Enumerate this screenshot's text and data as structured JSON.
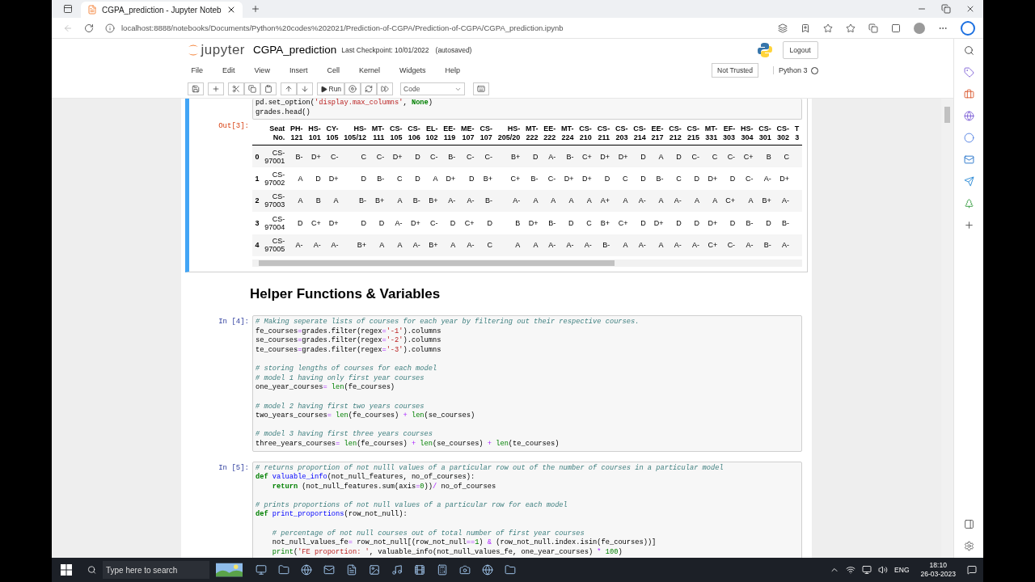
{
  "browser": {
    "tab": {
      "title": "CGPA_prediction - Jupyter Noteb",
      "selected": true
    },
    "url": "localhost:8888/notebooks/Documents/Python%20codes%202021/Prediction-of-CGPA/Prediction-of-CGPA/CGPA_prediction.ipynb"
  },
  "jupyter": {
    "logo": "jupyter",
    "notebook_name": "CGPA_prediction",
    "checkpoint": "Last Checkpoint: 10/01/2022",
    "autosave": "(autosaved)",
    "logout": "Logout",
    "menu": [
      "File",
      "Edit",
      "View",
      "Insert",
      "Cell",
      "Kernel",
      "Widgets",
      "Help"
    ],
    "trusted": "Not Trusted",
    "kernel": {
      "name": "Python 3",
      "busy": false
    },
    "toolbar": {
      "run": "Run",
      "cell_type": "Code"
    }
  },
  "cells": [
    {
      "kind": "code",
      "selected": true,
      "lines": [
        {
          "kind": "code",
          "tokens": [
            {
              "text": "pd.set_option(",
              "kind": "plain"
            },
            {
              "text": "'display.max_columns'",
              "kind": "str"
            },
            {
              "text": ", ",
              "kind": "plain"
            },
            {
              "text": "None",
              "kind": "kw"
            },
            {
              "text": ")",
              "kind": "plain"
            }
          ]
        },
        {
          "kind": "code",
          "tokens": [
            {
              "text": "grades.head()",
              "kind": "plain"
            }
          ]
        }
      ],
      "output": {
        "prompt": "Out[3]:",
        "table": {
          "columns": [
            "Seat No.",
            "PH-121",
            "HS-101",
            "CY-105",
            "HS-105/12",
            "MT-111",
            "CS-105",
            "CS-106",
            "EL-102",
            "EE-119",
            "ME-107",
            "CS-107",
            "HS-205/20",
            "MT-222",
            "EE-222",
            "MT-224",
            "CS-210",
            "CS-211",
            "CS-203",
            "CS-214",
            "EE-217",
            "CS-212",
            "CS-215",
            "MT-331",
            "EF-303",
            "HS-304",
            "CS-301",
            "CS-302",
            "T 3"
          ],
          "rows": [
            {
              "index": "0",
              "cells": [
                "CS-97001",
                "B-",
                "D+",
                "C-",
                "C",
                "C-",
                "D+",
                "D",
                "C-",
                "B-",
                "C-",
                "C-",
                "B+",
                "D",
                "A-",
                "B-",
                "C+",
                "D+",
                "D+",
                "D",
                "A",
                "D",
                "C-",
                "C",
                "C-",
                "C+",
                "B",
                "C"
              ]
            },
            {
              "index": "1",
              "cells": [
                "CS-97002",
                "A",
                "D",
                "D+",
                "D",
                "B-",
                "C",
                "D",
                "A",
                "D+",
                "D",
                "B+",
                "C+",
                "B-",
                "C-",
                "D+",
                "D+",
                "D",
                "C",
                "D",
                "B-",
                "C",
                "D",
                "D+",
                "D",
                "C-",
                "A-",
                "D+"
              ]
            },
            {
              "index": "2",
              "cells": [
                "CS-97003",
                "A",
                "B",
                "A",
                "B-",
                "B+",
                "A",
                "B-",
                "B+",
                "A-",
                "A-",
                "B-",
                "A-",
                "A",
                "A",
                "A",
                "A",
                "A+",
                "A",
                "A-",
                "A",
                "A-",
                "A",
                "A",
                "C+",
                "A",
                "B+",
                "A-"
              ]
            },
            {
              "index": "3",
              "cells": [
                "CS-97004",
                "D",
                "C+",
                "D+",
                "D",
                "D",
                "A-",
                "D+",
                "C-",
                "D",
                "C+",
                "D",
                "B",
                "D+",
                "B-",
                "D",
                "C",
                "B+",
                "C+",
                "D",
                "D+",
                "D",
                "D",
                "D+",
                "D",
                "B-",
                "D",
                "B-"
              ]
            },
            {
              "index": "4",
              "cells": [
                "CS-97005",
                "A-",
                "A-",
                "A-",
                "B+",
                "A",
                "A",
                "A-",
                "B+",
                "A",
                "A-",
                "C",
                "A",
                "A",
                "A-",
                "A-",
                "A-",
                "B-",
                "A",
                "A-",
                "A",
                "A-",
                "A-",
                "C+",
                "C-",
                "A-",
                "B-",
                "A-"
              ]
            }
          ]
        }
      }
    },
    {
      "kind": "markdown",
      "selected": false,
      "heading": "Helper Functions & Variables"
    },
    {
      "kind": "code",
      "prompt": "In [4]:",
      "selected": false,
      "lines": [
        {
          "kind": "code",
          "tokens": [
            {
              "text": "# Making seperate lists of courses for each year by filtering out their respective courses.",
              "kind": "comment"
            }
          ]
        },
        {
          "kind": "code",
          "tokens": [
            {
              "text": "fe_courses",
              "kind": "plain"
            },
            {
              "text": "=",
              "kind": "op"
            },
            {
              "text": "grades.filter(regex",
              "kind": "plain"
            },
            {
              "text": "=",
              "kind": "op"
            },
            {
              "text": "'-1'",
              "kind": "str"
            },
            {
              "text": ").columns",
              "kind": "plain"
            }
          ]
        },
        {
          "kind": "code",
          "tokens": [
            {
              "text": "se_courses",
              "kind": "plain"
            },
            {
              "text": "=",
              "kind": "op"
            },
            {
              "text": "grades.filter(regex",
              "kind": "plain"
            },
            {
              "text": "=",
              "kind": "op"
            },
            {
              "text": "'-2'",
              "kind": "str"
            },
            {
              "text": ").columns",
              "kind": "plain"
            }
          ]
        },
        {
          "kind": "code",
          "tokens": [
            {
              "text": "te_courses",
              "kind": "plain"
            },
            {
              "text": "=",
              "kind": "op"
            },
            {
              "text": "grades.filter(regex",
              "kind": "plain"
            },
            {
              "text": "=",
              "kind": "op"
            },
            {
              "text": "'-3'",
              "kind": "str"
            },
            {
              "text": ").columns",
              "kind": "plain"
            }
          ]
        },
        {
          "kind": "blank"
        },
        {
          "kind": "code",
          "tokens": [
            {
              "text": "# storing lengths of courses for each model",
              "kind": "comment"
            }
          ]
        },
        {
          "kind": "code",
          "tokens": [
            {
              "text": "# model 1 having only first year courses",
              "kind": "comment"
            }
          ]
        },
        {
          "kind": "code",
          "tokens": [
            {
              "text": "one_year_courses",
              "kind": "plain"
            },
            {
              "text": "= ",
              "kind": "op"
            },
            {
              "text": "len",
              "kind": "builtin"
            },
            {
              "text": "(fe_courses)",
              "kind": "plain"
            }
          ]
        },
        {
          "kind": "blank"
        },
        {
          "kind": "code",
          "tokens": [
            {
              "text": "# model 2 having first two years courses",
              "kind": "comment"
            }
          ]
        },
        {
          "kind": "code",
          "tokens": [
            {
              "text": "two_years_courses",
              "kind": "plain"
            },
            {
              "text": "= ",
              "kind": "op"
            },
            {
              "text": "len",
              "kind": "builtin"
            },
            {
              "text": "(fe_courses) ",
              "kind": "plain"
            },
            {
              "text": "+ ",
              "kind": "op"
            },
            {
              "text": "len",
              "kind": "builtin"
            },
            {
              "text": "(se_courses)",
              "kind": "plain"
            }
          ]
        },
        {
          "kind": "blank"
        },
        {
          "kind": "code",
          "tokens": [
            {
              "text": "# model 3 having first three years courses",
              "kind": "comment"
            }
          ]
        },
        {
          "kind": "code",
          "tokens": [
            {
              "text": "three_years_courses",
              "kind": "plain"
            },
            {
              "text": "= ",
              "kind": "op"
            },
            {
              "text": "len",
              "kind": "builtin"
            },
            {
              "text": "(fe_courses) ",
              "kind": "plain"
            },
            {
              "text": "+ ",
              "kind": "op"
            },
            {
              "text": "len",
              "kind": "builtin"
            },
            {
              "text": "(se_courses) ",
              "kind": "plain"
            },
            {
              "text": "+ ",
              "kind": "op"
            },
            {
              "text": "len",
              "kind": "builtin"
            },
            {
              "text": "(te_courses)",
              "kind": "plain"
            }
          ]
        }
      ]
    },
    {
      "kind": "code",
      "prompt": "In [5]:",
      "selected": false,
      "lines": [
        {
          "kind": "code",
          "tokens": [
            {
              "text": "# returns proportion of not nulll values of a particular row out of the number of courses in a particular model",
              "kind": "comment"
            }
          ]
        },
        {
          "kind": "code",
          "tokens": [
            {
              "text": "def ",
              "kind": "kw"
            },
            {
              "text": "valuable_info",
              "kind": "fn"
            },
            {
              "text": "(not_null_features, no_of_courses):",
              "kind": "plain"
            }
          ]
        },
        {
          "kind": "code",
          "tokens": [
            {
              "text": "    return",
              "kind": "kw"
            },
            {
              "text": " (not_null_features.sum(axis",
              "kind": "plain"
            },
            {
              "text": "=",
              "kind": "op"
            },
            {
              "text": "0",
              "kind": "num"
            },
            {
              "text": "))",
              "kind": "plain"
            },
            {
              "text": "/",
              "kind": "op"
            },
            {
              "text": " no_of_courses",
              "kind": "plain"
            }
          ]
        },
        {
          "kind": "blank"
        },
        {
          "kind": "code",
          "tokens": [
            {
              "text": "# prints proportions of not null values of a particular row for each model",
              "kind": "comment"
            }
          ]
        },
        {
          "kind": "code",
          "tokens": [
            {
              "text": "def ",
              "kind": "kw"
            },
            {
              "text": "print_proportions",
              "kind": "fn"
            },
            {
              "text": "(row_not_null):",
              "kind": "plain"
            }
          ]
        },
        {
          "kind": "blank"
        },
        {
          "kind": "code",
          "tokens": [
            {
              "text": "    # percentage of not null courses out of total number of first year courses",
              "kind": "comment"
            }
          ]
        },
        {
          "kind": "code",
          "tokens": [
            {
              "text": "    not_null_values_fe",
              "kind": "plain"
            },
            {
              "text": "=",
              "kind": "op"
            },
            {
              "text": " row_not_null[(row_not_null",
              "kind": "plain"
            },
            {
              "text": "==",
              "kind": "op"
            },
            {
              "text": "1",
              "kind": "num"
            },
            {
              "text": ") ",
              "kind": "plain"
            },
            {
              "text": "&",
              "kind": "op"
            },
            {
              "text": " (row_not_null.index.isin(fe_courses))]",
              "kind": "plain"
            }
          ]
        },
        {
          "kind": "code",
          "tokens": [
            {
              "text": "    print",
              "kind": "builtin"
            },
            {
              "text": "(",
              "kind": "plain"
            },
            {
              "text": "'FE proportion: '",
              "kind": "str"
            },
            {
              "text": ", valuable_info(not_null_values_fe, one_year_courses) ",
              "kind": "plain"
            },
            {
              "text": "* ",
              "kind": "op"
            },
            {
              "text": "100",
              "kind": "num"
            },
            {
              "text": ")",
              "kind": "plain"
            }
          ]
        }
      ]
    }
  ],
  "taskbar": {
    "search": {
      "placeholder": "Type here to search"
    },
    "language": "ENG",
    "time": "18:10",
    "date": "26-03-2023"
  }
}
